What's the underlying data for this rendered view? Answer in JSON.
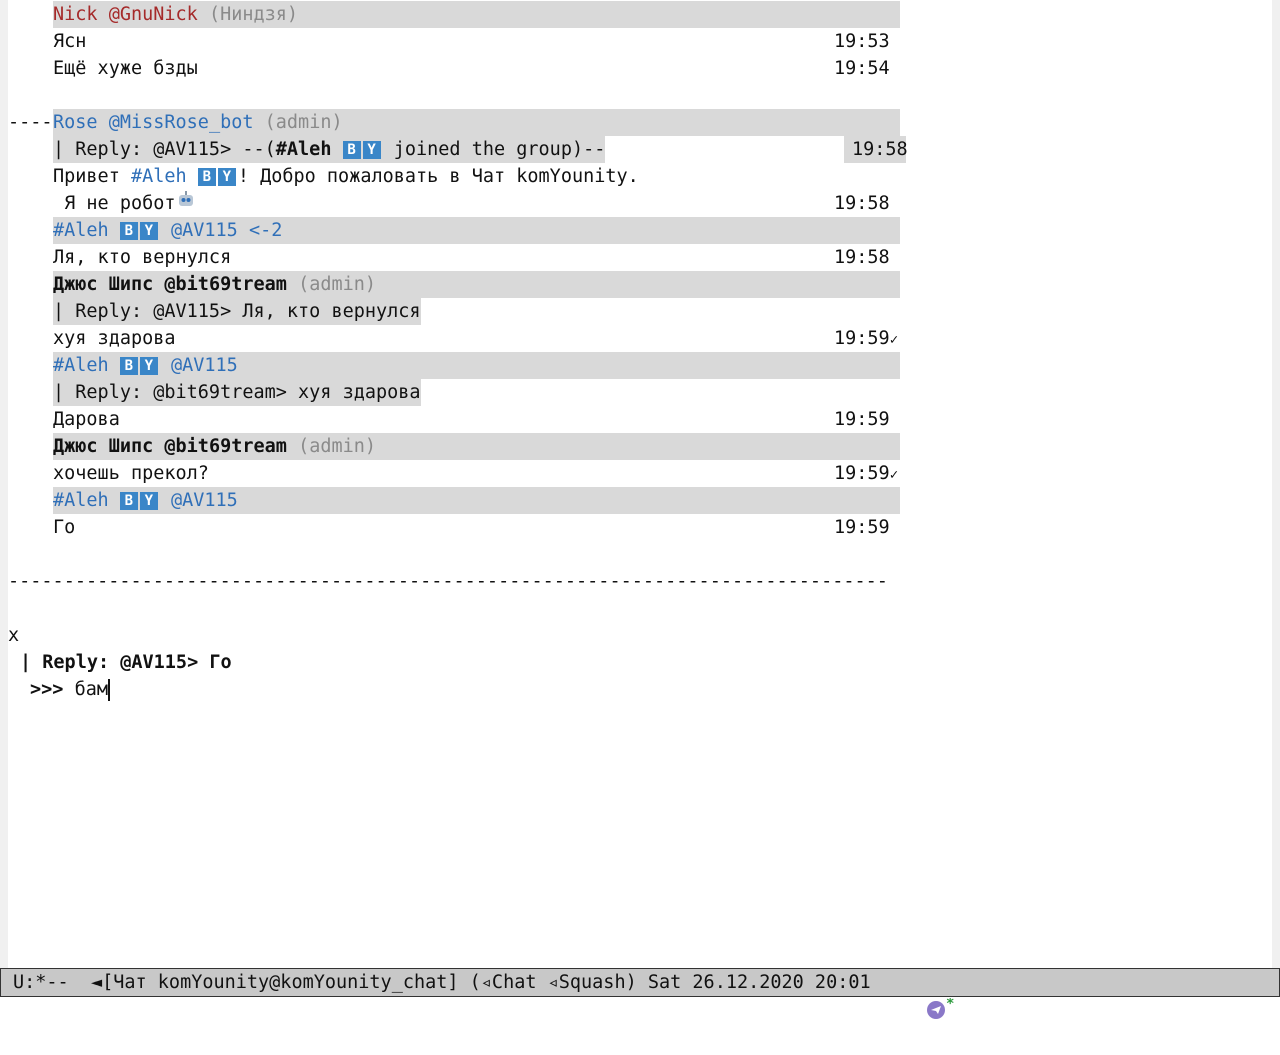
{
  "messages": {
    "m1": {
      "name": "Nick",
      "user": "@GnuNick",
      "role": "(Ниндзя)",
      "line1": "Ясн",
      "time1": "19:53",
      "line2": "Ещё хуже бзды",
      "time2": "19:54"
    },
    "join": {
      "left_dashes": "---------------------(",
      "who": "#Aleh",
      "text": " joined the group)----------------------",
      "time": "19:58"
    },
    "m2": {
      "name": "Rose",
      "user": "@MissRose_bot",
      "role": "(admin)",
      "reply_prefix": "| Reply: @AV115> --(",
      "reply_who": "#Aleh",
      "reply_rest": " joined the group)--",
      "greet_a": "Привет ",
      "greet_who": "#Aleh",
      "greet_b": "! Добро пожаловать в Чат komYounity.",
      "robot": " Я не робот",
      "time": "19:58"
    },
    "m3": {
      "name": "#Aleh",
      "user": "@AV115",
      "extra": "<-2",
      "text": "Ля, кто вернулся",
      "time": "19:58"
    },
    "m4": {
      "name": "Джюс Шипс",
      "user": "@bit69tream",
      "role": "(admin)",
      "reply": "| Reply: @AV115> Ля, кто вернулся",
      "text": "хуя здарова",
      "time": "19:59",
      "check": "✓"
    },
    "m5": {
      "name": "#Aleh",
      "user": "@AV115",
      "reply": "| Reply: @bit69tream> хуя здарова",
      "text": "Дарова",
      "time": "19:59"
    },
    "m6": {
      "name": "Джюс Шипс",
      "user": "@bit69tream",
      "role": "(admin)",
      "text": "хочешь прекол?",
      "time": "19:59",
      "check": "✓"
    },
    "m7": {
      "name": "#Aleh",
      "user": "@AV115",
      "text": "Го",
      "time": "19:59"
    }
  },
  "badge": {
    "b": "B",
    "y": "Y"
  },
  "separator": "-------------------------------------------------------------------------------",
  "compose": {
    "close": "x",
    "reply": "| Reply: @AV115> Го",
    "prompt": ">>> ",
    "input": "бам"
  },
  "modeline": {
    "text": "U:*--  ◄[Чат komYounity@komYounity_chat] (◃Chat ◃Squash) Sat 26.12.2020 20:01"
  },
  "colors": {
    "header_bg": "#d9d9d9",
    "nick_red": "#a52a2a",
    "link_blue": "#2f6fb8",
    "badge_blue": "#3a86c8"
  }
}
